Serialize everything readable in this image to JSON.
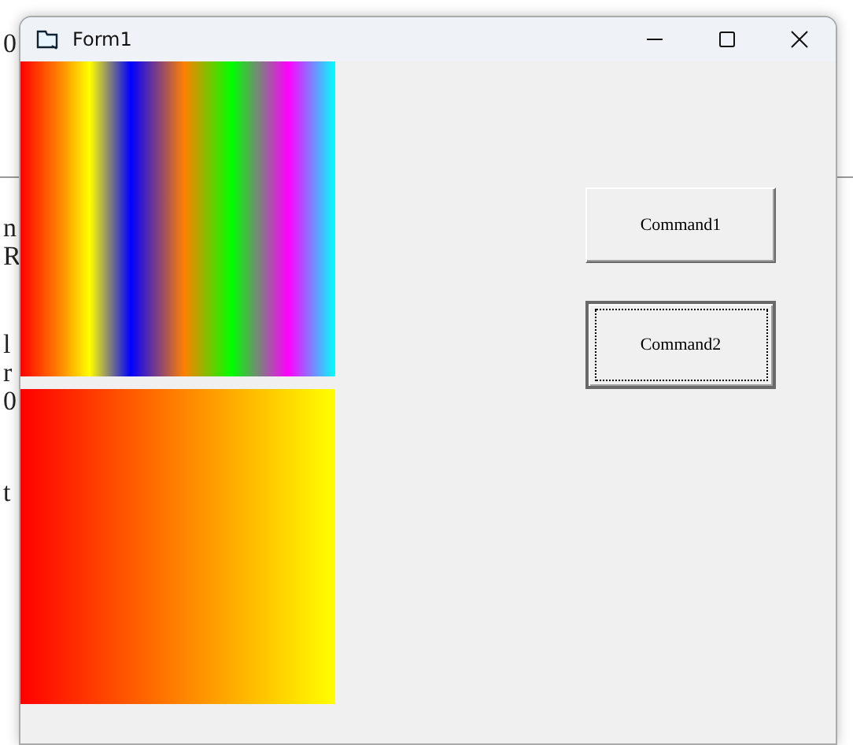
{
  "editor": {
    "fragments": [
      "0",
      "n",
      "R",
      "l",
      "r",
      "0",
      "t"
    ]
  },
  "window": {
    "title": "Form1"
  },
  "buttons": [
    {
      "label": "Command1",
      "focused": false
    },
    {
      "label": "Command2",
      "focused": true
    }
  ]
}
